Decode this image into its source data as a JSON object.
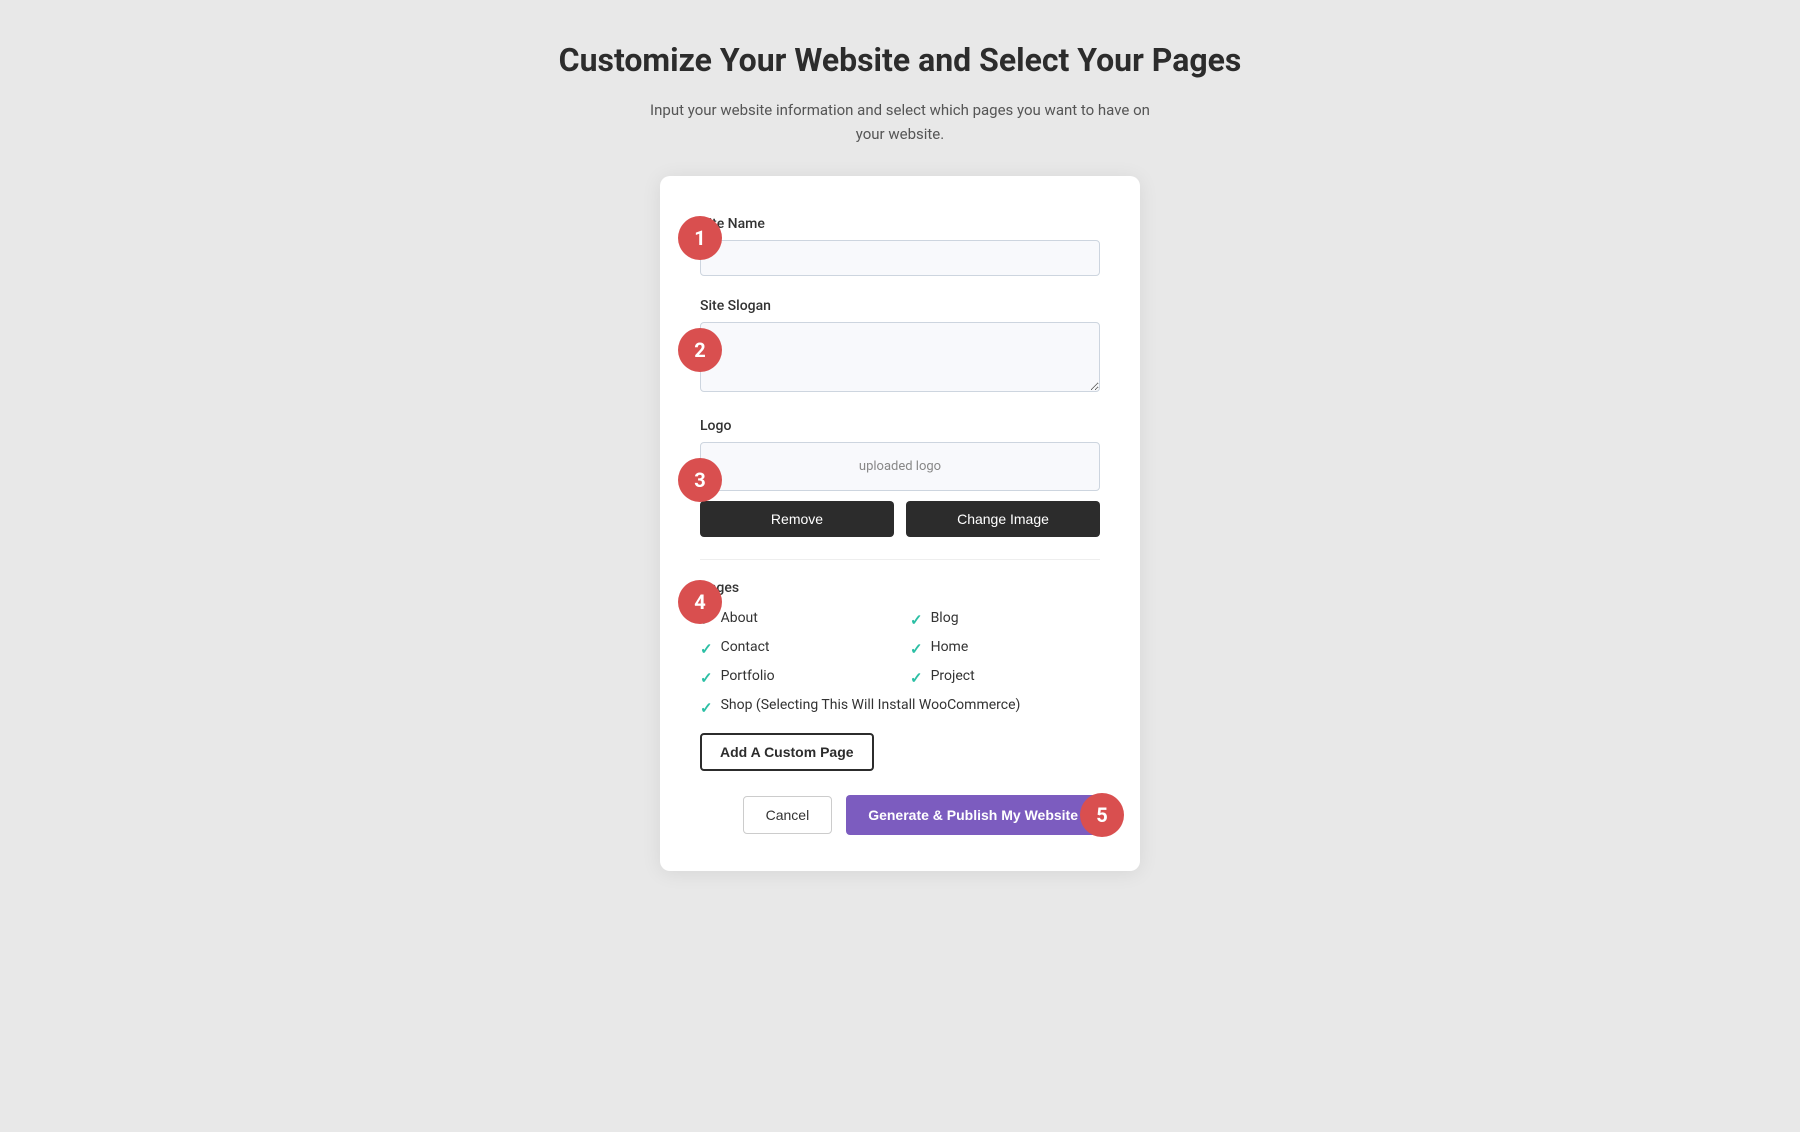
{
  "header": {
    "title": "Customize Your Website and Select Your Pages",
    "subtitle": "Input your website information and select which pages you want to have on your website."
  },
  "form": {
    "site_name_label": "Site Name",
    "site_name_placeholder": "",
    "site_slogan_label": "Site Slogan",
    "site_slogan_placeholder": "",
    "logo_label": "Logo",
    "logo_placeholder": "uploaded logo",
    "remove_button": "Remove",
    "change_image_button": "Change Image",
    "pages_label": "Pages",
    "pages": [
      {
        "label": "About",
        "checked": true,
        "column": 1
      },
      {
        "label": "Blog",
        "checked": true,
        "column": 2
      },
      {
        "label": "Contact",
        "checked": true,
        "column": 1
      },
      {
        "label": "Home",
        "checked": true,
        "column": 2
      },
      {
        "label": "Portfolio",
        "checked": true,
        "column": 1
      },
      {
        "label": "Project",
        "checked": true,
        "column": 2
      }
    ],
    "shop_page_label": "Shop (Selecting This Will Install WooCommerce)",
    "shop_checked": true,
    "add_custom_page_button": "Add A Custom Page",
    "cancel_button": "Cancel",
    "generate_button": "Generate & Publish My Website"
  },
  "steps": {
    "step1": "1",
    "step2": "2",
    "step3": "3",
    "step4": "4",
    "step5": "5"
  },
  "colors": {
    "step_badge": "#d94f4f",
    "check_color": "#2bbfa4",
    "primary_button": "#7c5cbf"
  }
}
